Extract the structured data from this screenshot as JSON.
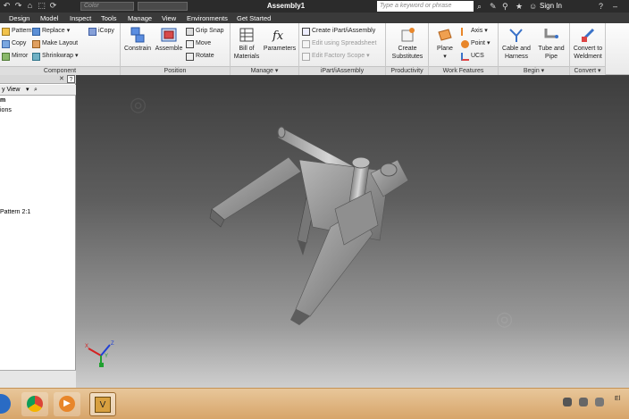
{
  "window": {
    "title": "Assembly1"
  },
  "qat": {
    "color_combo": "Color",
    "search_placeholder": "Type a keyword or phrase",
    "sign_in": "Sign In"
  },
  "tabs": [
    "Design",
    "Model",
    "Inspect",
    "Tools",
    "Manage",
    "View",
    "Environments",
    "Get Started"
  ],
  "ribbon": {
    "component": {
      "label": "Component",
      "col1": [
        "Pattern",
        "Copy",
        "Mirror"
      ],
      "col2": [
        "Replace",
        "Make Layout",
        "Shrinkwrap"
      ],
      "col3": [
        "iCopy"
      ]
    },
    "position": {
      "label": "Position",
      "constrain": "Constrain",
      "assemble": "Assemble",
      "grip_snap": "Grip Snap",
      "move": "Move",
      "rotate": "Rotate"
    },
    "manage": {
      "label": "Manage",
      "bom_line1": "Bill of",
      "bom_line2": "Materials",
      "parameters": "Parameters"
    },
    "ipart": {
      "label": "iPart/iAssembly",
      "create": "Create iPart/iAssembly",
      "edit_ss": "Edit using Spreadsheet",
      "edit_scope": "Edit Factory Scope"
    },
    "productivity": {
      "label": "Productivity",
      "line1": "Create",
      "line2": "Substitutes"
    },
    "work_features": {
      "label": "Work Features",
      "plane": "Plane",
      "axis": "Axis",
      "point": "Point",
      "ucs": "UCS"
    },
    "begin": {
      "label": "Begin",
      "cable1": "Cable and",
      "cable2": "Harness",
      "tube1": "Tube and",
      "tube2": "Pipe"
    },
    "convert": {
      "label": "Convert",
      "line1": "Convert to",
      "line2": "Weldment"
    }
  },
  "browser": {
    "view_label": "y View",
    "tree": [
      "m",
      "ions",
      "Pattern 2:1"
    ]
  },
  "triad": {
    "x": "X",
    "y": "Y",
    "z": "Z"
  },
  "taskbar": {
    "clock_frag": "El"
  },
  "colors": {
    "accent_orange": "#e8862a",
    "constrain_blue": "#3a72c8",
    "viewport_dark": "#3d3d3d"
  }
}
